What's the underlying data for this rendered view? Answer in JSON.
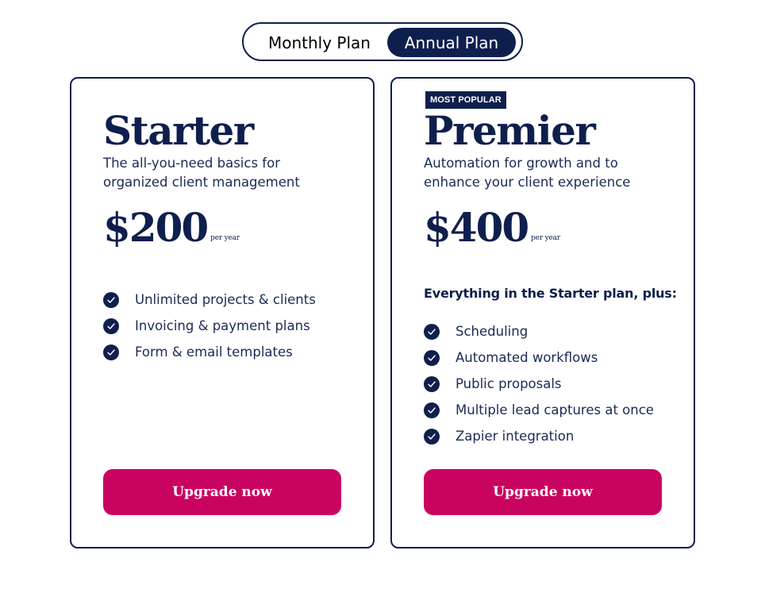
{
  "toggle": {
    "monthly_label": "Monthly Plan",
    "annual_label": "Annual Plan",
    "selected": "Annual Plan"
  },
  "colors": {
    "navy": "#0f1f4d",
    "cta": "#c90460",
    "background": "#ffffff"
  },
  "plans": [
    {
      "name": "Starter",
      "description": "The all-you-need basics for organized client management",
      "price": "$200",
      "period": "per year",
      "features": [
        "Unlimited projects & clients",
        "Invoicing & payment plans",
        "Form & email templates"
      ],
      "cta": "Upgrade now"
    },
    {
      "badge": "MOST POPULAR",
      "name": "Premier",
      "description": "Automation for growth and to enhance your client experience",
      "price": "$400",
      "period": "per year",
      "includes_heading": "Everything in the Starter plan, plus:",
      "features": [
        "Scheduling",
        "Automated workflows",
        "Public proposals",
        "Multiple lead captures at once",
        "Zapier integration"
      ],
      "cta": "Upgrade now"
    }
  ],
  "icons": {
    "feature_check": "check-circle-icon"
  }
}
